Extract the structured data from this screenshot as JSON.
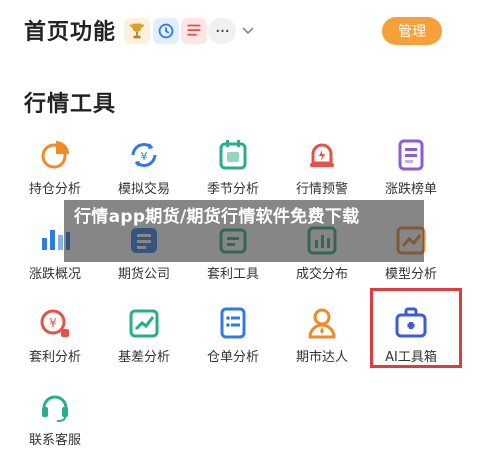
{
  "header": {
    "title": "首页功能",
    "more_label": "···",
    "manage_label": "管理"
  },
  "section": {
    "title": "行情工具"
  },
  "tiles": [
    {
      "label": "持仓分析",
      "icon": "pie-chart-icon",
      "color": "#f08a2a"
    },
    {
      "label": "模拟交易",
      "icon": "yen-exchange-icon",
      "color": "#2f7be6"
    },
    {
      "label": "季节分析",
      "icon": "calendar-season-icon",
      "color": "#27ae8a"
    },
    {
      "label": "行情预警",
      "icon": "alarm-bell-icon",
      "color": "#e8504a"
    },
    {
      "label": "涨跌榜单",
      "icon": "ranking-list-icon",
      "color": "#8e5bd6"
    },
    {
      "label": "涨跌概况",
      "icon": "bar-chart-icon",
      "color": "#2f7be6"
    },
    {
      "label": "期货公司",
      "icon": "company-icon",
      "color": "#2f7be6"
    },
    {
      "label": "套利工具",
      "icon": "tools-icon",
      "color": "#27ae8a"
    },
    {
      "label": "成交分布",
      "icon": "distribution-icon",
      "color": "#27ae8a"
    },
    {
      "label": "模型分析",
      "icon": "model-chart-icon",
      "color": "#f08a2a"
    },
    {
      "label": "套利分析",
      "icon": "arbitrage-icon",
      "color": "#e8504a"
    },
    {
      "label": "基差分析",
      "icon": "trend-chart-icon",
      "color": "#27ae8a"
    },
    {
      "label": "仓单分析",
      "icon": "document-list-icon",
      "color": "#2f7be6"
    },
    {
      "label": "期市达人",
      "icon": "expert-user-icon",
      "color": "#f08a2a"
    },
    {
      "label": "AI工具箱",
      "icon": "toolbox-icon",
      "color": "#3d5bd9"
    },
    {
      "label": "联系客服",
      "icon": "headset-icon",
      "color": "#27ae8a"
    }
  ],
  "banner": {
    "text": "行情app期货/期货行情软件免费下载"
  }
}
